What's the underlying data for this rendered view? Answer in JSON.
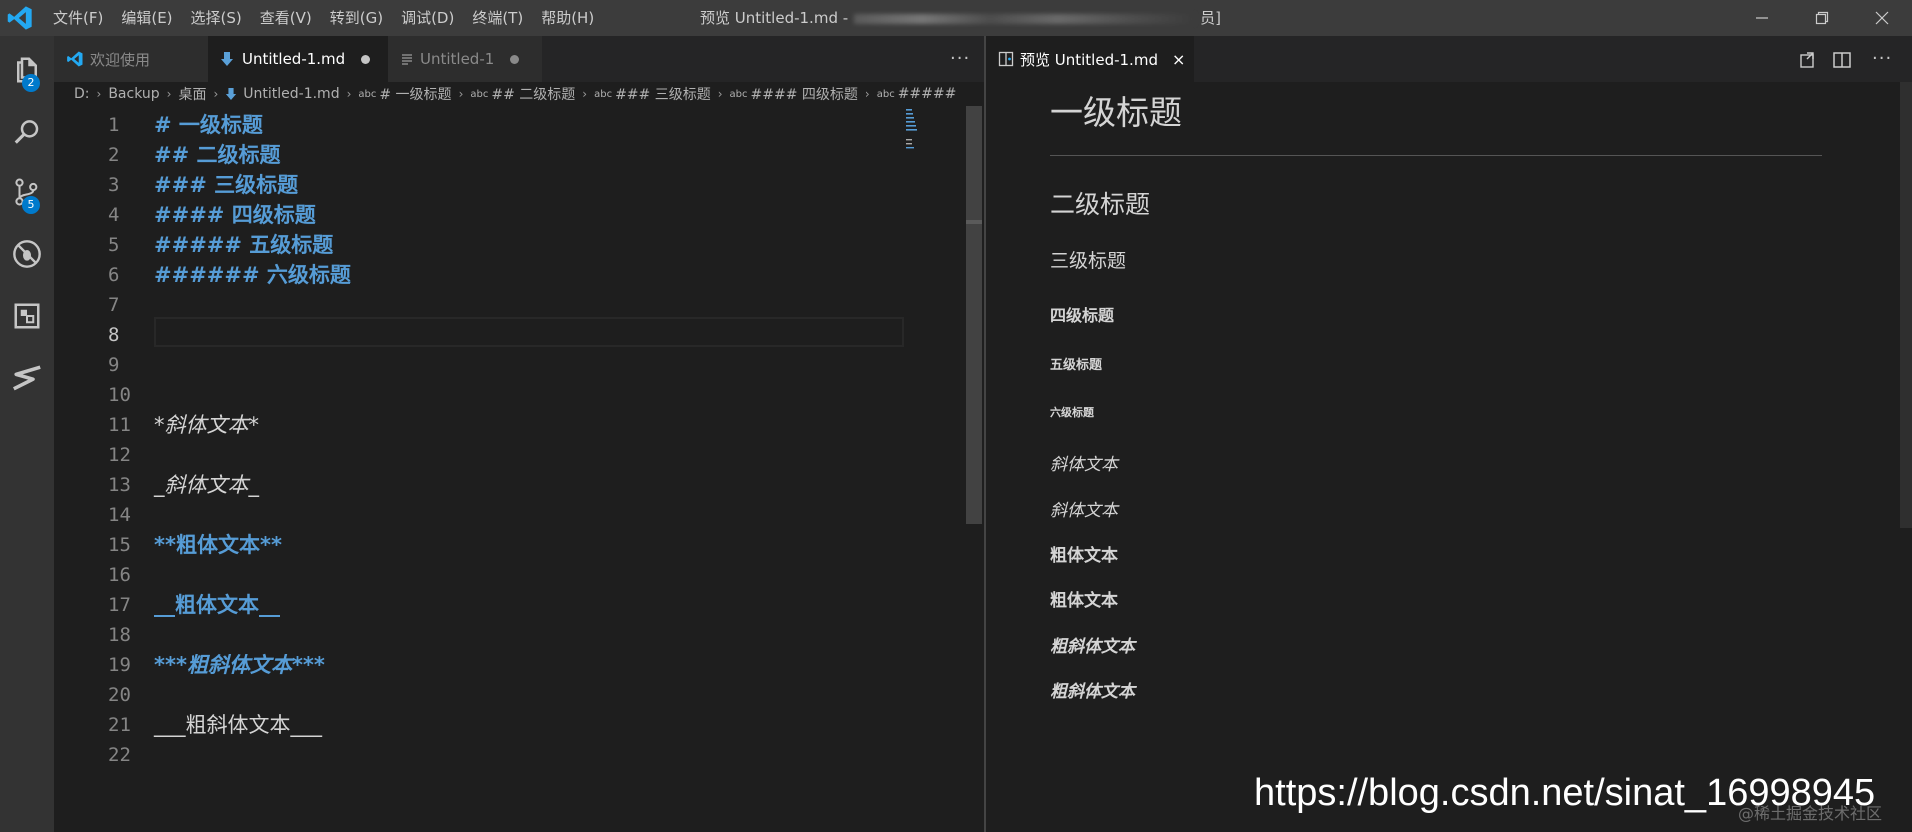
{
  "titlebar": {
    "menus": [
      "文件(F)",
      "编辑(E)",
      "选择(S)",
      "查看(V)",
      "转到(G)",
      "调试(D)",
      "终端(T)",
      "帮助(H)"
    ],
    "title_prefix": "预览 Untitled-1.md -",
    "title_suffix": "员]"
  },
  "activity": {
    "explorer_badge": "2",
    "scm_badge": "5"
  },
  "editor1": {
    "tabs": [
      {
        "label": "欢迎使用",
        "icon": "vscode-icon"
      },
      {
        "label": "Untitled-1.md",
        "icon": "markdown-icon"
      },
      {
        "label": "Untitled-1",
        "icon": "text-file-icon"
      }
    ],
    "more": "···",
    "breadcrumb": [
      {
        "label": "D:"
      },
      {
        "label": "Backup"
      },
      {
        "label": "桌面"
      },
      {
        "label": "Untitled-1.md"
      },
      {
        "label": "# 一级标题",
        "abc": "abc"
      },
      {
        "label": "## 二级标题",
        "abc": "abc"
      },
      {
        "label": "### 三级标题",
        "abc": "abc"
      },
      {
        "label": "#### 四级标题",
        "abc": "abc"
      },
      {
        "label": "#####",
        "abc": "abc"
      }
    ],
    "lines": [
      {
        "n": "1",
        "text": "# 一级标题",
        "style": "md-heading"
      },
      {
        "n": "2",
        "text": "## 二级标题",
        "style": "md-heading"
      },
      {
        "n": "3",
        "text": "### 三级标题",
        "style": "md-heading"
      },
      {
        "n": "4",
        "text": "#### 四级标题",
        "style": "md-heading"
      },
      {
        "n": "5",
        "text": "##### 五级标题",
        "style": "md-heading"
      },
      {
        "n": "6",
        "text": "###### 六级标题",
        "style": "md-heading"
      },
      {
        "n": "7",
        "text": "",
        "style": "md-plain"
      },
      {
        "n": "8",
        "text": "",
        "style": "md-plain"
      },
      {
        "n": "9",
        "text": "",
        "style": "md-plain"
      },
      {
        "n": "10",
        "text": "",
        "style": "md-plain"
      },
      {
        "n": "11",
        "text": "*斜体文本*",
        "style": "md-italic"
      },
      {
        "n": "12",
        "text": "",
        "style": "md-plain"
      },
      {
        "n": "13",
        "text": "_斜体文本_",
        "style": "md-italic"
      },
      {
        "n": "14",
        "text": "",
        "style": "md-plain"
      },
      {
        "n": "15",
        "text": "**粗体文本**",
        "style": "md-bold"
      },
      {
        "n": "16",
        "text": "",
        "style": "md-plain"
      },
      {
        "n": "17",
        "text": "__粗体文本__",
        "style": "md-bold"
      },
      {
        "n": "18",
        "text": "",
        "style": "md-plain"
      },
      {
        "n": "19",
        "text": "***粗斜体文本***",
        "style": "md-bolditalic"
      },
      {
        "n": "20",
        "text": "",
        "style": "md-plain"
      },
      {
        "n": "21",
        "text": "___粗斜体文本___",
        "style": "md-plain"
      },
      {
        "n": "22",
        "text": "",
        "style": "md-plain"
      }
    ],
    "current_line": "8"
  },
  "editor2": {
    "tab_label": "预览 Untitled-1.md",
    "close": "×",
    "preview": {
      "h1": "一级标题",
      "h2": "二级标题",
      "h3": "三级标题",
      "h4": "四级标题",
      "h5": "五级标题",
      "h6": "六级标题",
      "em1": "斜体文本",
      "em2": "斜体文本",
      "strong1": "粗体文本",
      "strong2": "粗体文本",
      "strongem1": "粗斜体文本",
      "strongem2": "粗斜体文本"
    }
  },
  "watermark": "https://blog.csdn.net/sinat_16998945",
  "watermark_faint": "@稀土掘金技术社区",
  "colors": {
    "accent": "#007acc",
    "heading": "#569cd6",
    "vscode_blue": "#23a9f2"
  }
}
